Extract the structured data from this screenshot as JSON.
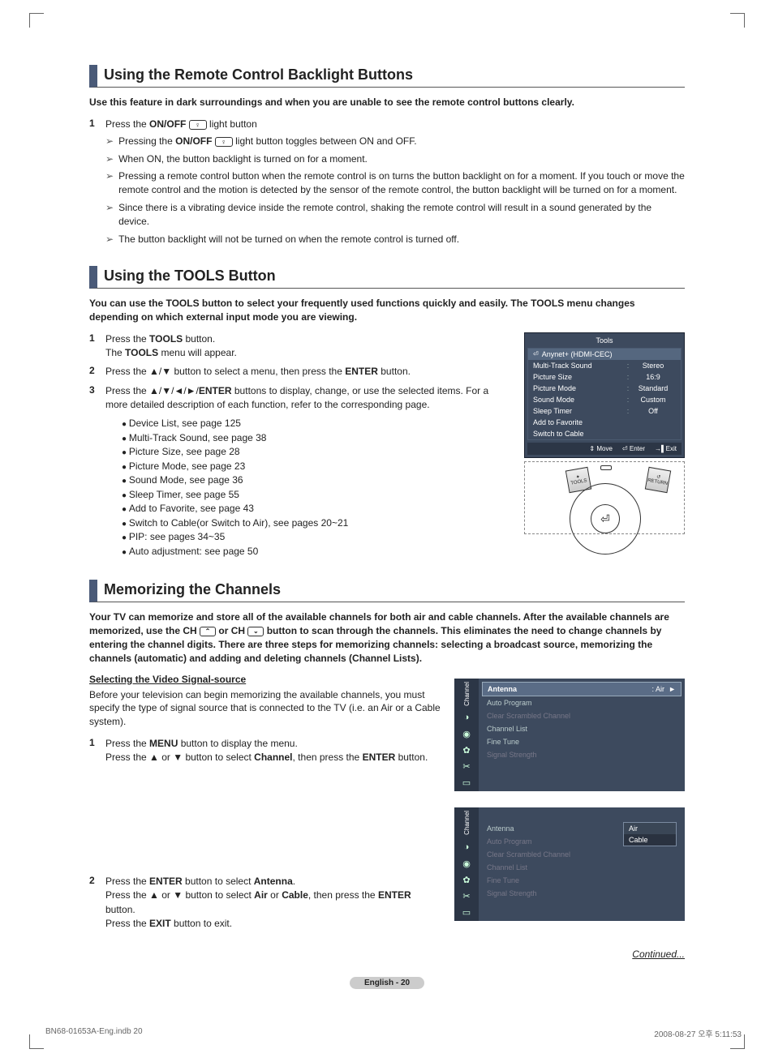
{
  "section1": {
    "title": "Using the Remote Control Backlight Buttons",
    "intro": "Use this feature in dark surroundings and when you are unable to see the remote control buttons clearly.",
    "step1_prefix": "Press the ",
    "step1_bold": "ON/OFF",
    "step1_suffix": " light button",
    "a1_prefix": "Pressing the ",
    "a1_bold": "ON/OFF",
    "a1_suffix": " light button toggles between ON and OFF.",
    "a2": "When ON, the button backlight is turned on for a moment.",
    "a3": "Pressing a remote control button when the remote control is on turns the button backlight on for a moment. If you touch or move the remote control and the motion is detected by the sensor of the remote control, the button backlight will be turned on for a moment.",
    "a4": "Since there is a vibrating device inside the remote control, shaking the remote control will result in a sound generated by the device.",
    "a5": "The button backlight will not be turned on when the remote control is turned off."
  },
  "section2": {
    "title": "Using the TOOLS Button",
    "intro": "You can use the TOOLS button to select your frequently used functions quickly and easily. The TOOLS menu changes depending on which external input mode you are viewing.",
    "s1a": "Press the ",
    "s1b": "TOOLS",
    "s1c": " button.",
    "s1d": "The ",
    "s1e": "TOOLS",
    "s1f": " menu will appear.",
    "s2": "Press the ▲/▼ button to select a menu, then press the ",
    "s2b": "ENTER",
    "s2c": " button.",
    "s3a": "Press the ▲/▼/◄/►/",
    "s3b": "ENTER",
    "s3c": " buttons to display, change, or use the selected items. For a more detailed description of each function, refer to the corresponding page.",
    "list": [
      "Device List, see page 125",
      "Multi-Track Sound, see page 38",
      "Picture Size, see page 28",
      "Picture Mode, see page 23",
      "Sound Mode, see page 36",
      "Sleep Timer, see page 55",
      "Add to Favorite, see page 43",
      "Switch to Cable(or Switch to Air), see pages 20~21",
      "PIP: see pages 34~35",
      "Auto adjustment: see page 50"
    ]
  },
  "tools_osd": {
    "title": "Tools",
    "highlight": "Anynet+ (HDMI-CEC)",
    "rows": [
      {
        "lbl": "Multi-Track Sound",
        "val": "Stereo"
      },
      {
        "lbl": "Picture Size",
        "val": "16:9"
      },
      {
        "lbl": "Picture Mode",
        "val": "Standard"
      },
      {
        "lbl": "Sound Mode",
        "val": "Custom"
      },
      {
        "lbl": "Sleep Timer",
        "val": "Off"
      },
      {
        "lbl": "Add to Favorite",
        "val": ""
      },
      {
        "lbl": "Switch to Cable",
        "val": ""
      }
    ],
    "footer": {
      "move": "Move",
      "enter": "Enter",
      "exit": "Exit"
    }
  },
  "remote": {
    "tools": "TOOLS",
    "return": "RETURN",
    "enter": "⏎"
  },
  "section3": {
    "title": "Memorizing the Channels",
    "intro_a": "Your TV can memorize and store all of the available channels for both air and cable channels. After the available channels are memorized, use the CH ",
    "intro_b": " or CH ",
    "intro_c": " button to scan through the channels. This eliminates the need to change channels by entering the channel digits. There are three steps for memorizing channels: selecting a broadcast source, memorizing the channels (automatic) and adding and deleting channels (Channel Lists).",
    "sub": "Selecting the Video Signal-source",
    "subp": "Before your television can begin memorizing the available channels, you must specify the type of signal source that is connected to the TV (i.e. an Air or a Cable system).",
    "s1a": "Press the ",
    "s1b": "MENU",
    "s1c": " button to display the menu.",
    "s1d": "Press the ▲ or ▼ button to select ",
    "s1e": "Channel",
    "s1f": ", then press the ",
    "s1g": "ENTER",
    "s1h": " button.",
    "s2a": "Press the ",
    "s2b": "ENTER",
    "s2c": " button to select ",
    "s2d": "Antenna",
    "s2e": ".",
    "s2f": "Press the ▲ or ▼ button to select ",
    "s2g": "Air",
    "s2h": " or ",
    "s2i": "Cable",
    "s2j": ", then press the ",
    "s2k": "ENTER",
    "s2l": " button.",
    "s2m": "Press the ",
    "s2n": "EXIT",
    "s2o": " button to exit."
  },
  "osd1": {
    "side_label": "Channel",
    "antenna_lbl": "Antenna",
    "antenna_val": ": Air",
    "arrow": "►",
    "items": [
      "Auto Program",
      "Clear Scrambled Channel",
      "Channel List",
      "Fine Tune",
      "Signal Strength"
    ]
  },
  "osd2": {
    "side_label": "Channel",
    "items": [
      "Antenna",
      "Auto Program",
      "Clear Scrambled Channel",
      "Channel List",
      "Fine Tune",
      "Signal Strength"
    ],
    "dd": [
      "Air",
      "Cable"
    ]
  },
  "continued": "Continued...",
  "page_label": "English - 20",
  "doc_footer": {
    "left": "BN68-01653A-Eng.indb   20",
    "right": "2008-08-27   오후 5:11:53"
  }
}
